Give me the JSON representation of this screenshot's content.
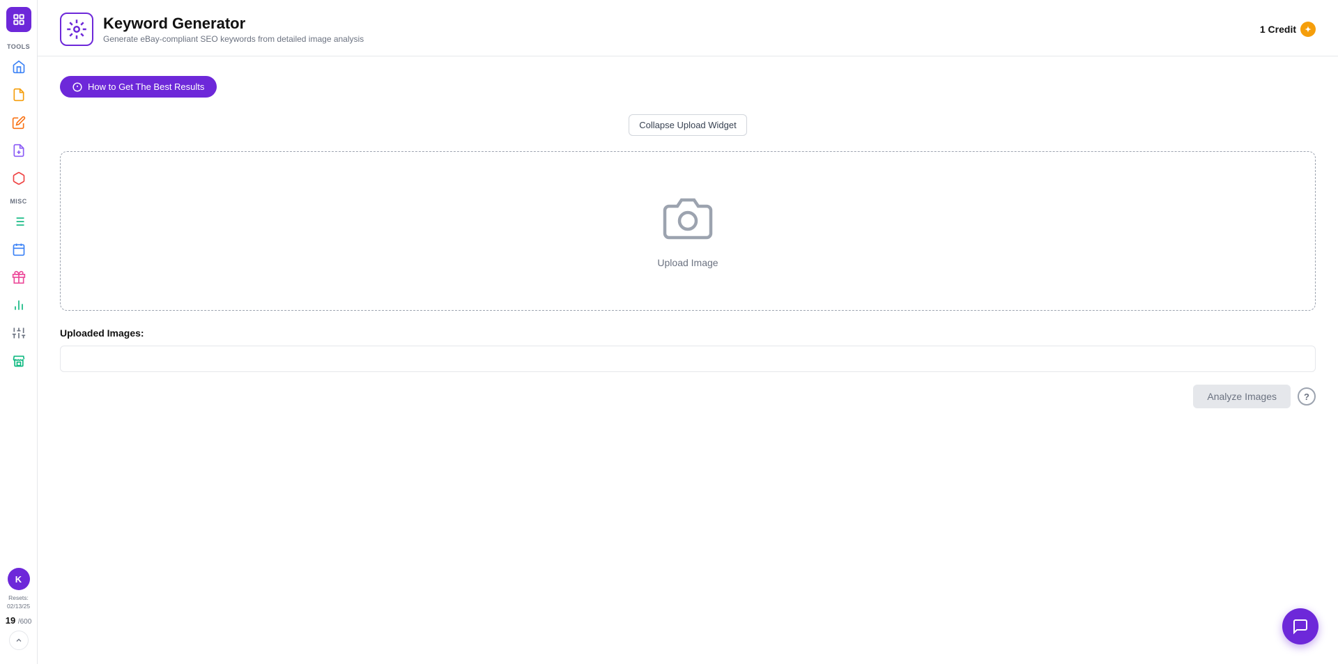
{
  "sidebar": {
    "tools_label": "TOOLS",
    "misc_label": "MISC",
    "icons": [
      {
        "name": "home-icon",
        "symbol": "⌂"
      },
      {
        "name": "document-icon",
        "symbol": "📄"
      },
      {
        "name": "note-icon",
        "symbol": "📝"
      },
      {
        "name": "upload-doc-icon",
        "symbol": "📤"
      },
      {
        "name": "cube-icon",
        "symbol": "🧊"
      },
      {
        "name": "list-icon",
        "symbol": "☰"
      },
      {
        "name": "calendar-icon",
        "symbol": "📅"
      },
      {
        "name": "gift-icon",
        "symbol": "🎁"
      },
      {
        "name": "chart-icon",
        "symbol": "📊"
      },
      {
        "name": "sliders-icon",
        "symbol": "🎚"
      },
      {
        "name": "store-icon",
        "symbol": "🏪"
      }
    ],
    "avatar_initial": "K",
    "resets_label": "Resets:",
    "resets_date": "02/13/25",
    "usage_count": "19",
    "usage_max": "/600"
  },
  "header": {
    "title": "Keyword Generator",
    "subtitle": "Generate eBay-compliant SEO keywords from detailed image analysis",
    "credit_label": "1 Credit"
  },
  "toolbar": {
    "how_to_label": "How to Get The Best Results",
    "collapse_widget_label": "Collapse Upload Widget"
  },
  "upload": {
    "placeholder_text": "Upload Image"
  },
  "uploaded_section": {
    "label": "Uploaded Images:"
  },
  "actions": {
    "analyze_label": "Analyze Images"
  },
  "colors": {
    "purple": "#6d28d9",
    "gray_border": "#d1d5db",
    "gray_text": "#6b7280"
  }
}
